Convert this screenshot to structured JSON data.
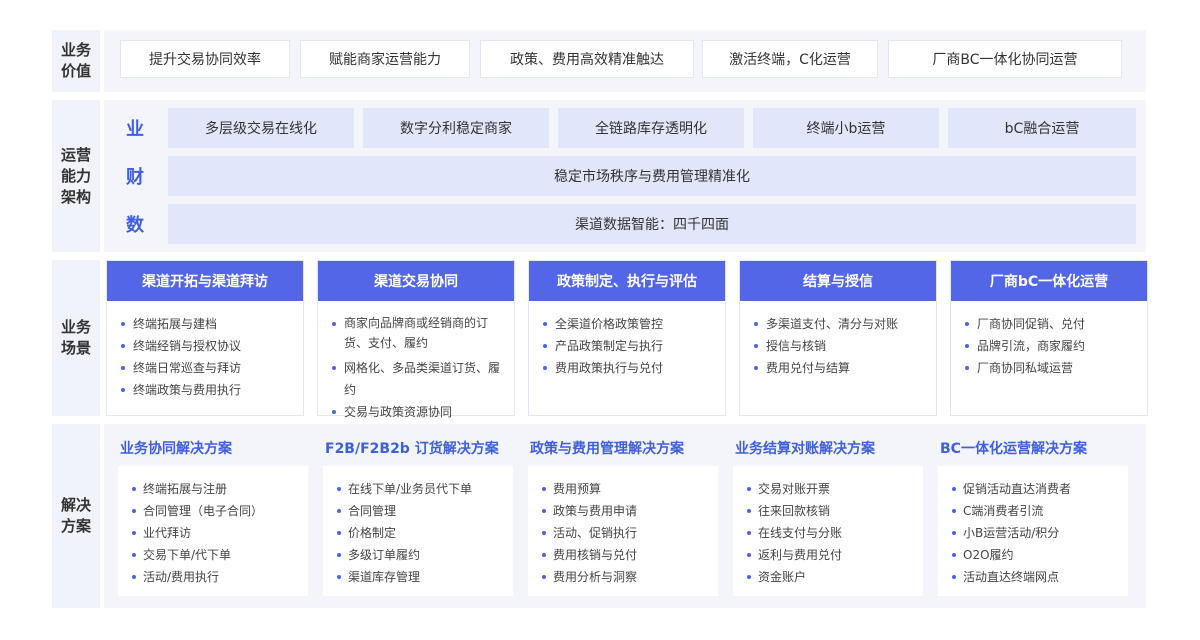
{
  "rows": {
    "value_label": "业务价值",
    "arch_label": "运营能力架构",
    "scene_label": "业务场景",
    "solution_label": "解决方案"
  },
  "value_items": [
    "提升交易协同效率",
    "赋能商家运营能力",
    "政策、费用高效精准触达",
    "激活终端，C化运营",
    "厂商BC一体化协同运营"
  ],
  "arch": {
    "tags": [
      "业",
      "财",
      "数"
    ],
    "biz_cells": [
      "多层级交易在线化",
      "数字分利稳定商家",
      "全链路库存透明化",
      "终端小b运营",
      "bC融合运营"
    ],
    "finance_cell": "稳定市场秩序与费用管理精准化",
    "data_cell": "渠道数据智能：四千四面"
  },
  "scenes": [
    {
      "title": "渠道开拓与渠道拜访",
      "items": [
        "终端拓展与建档",
        "终端经销与授权协议",
        "终端日常巡查与拜访",
        "终端政策与费用执行"
      ]
    },
    {
      "title": "渠道交易协同",
      "items": [
        "商家向品牌商或经销商的订货、支付、履约",
        "网格化、多品类渠道订货、履约",
        "交易与政策资源协同"
      ]
    },
    {
      "title": "政策制定、执行与评估",
      "items": [
        "全渠道价格政策管控",
        "产品政策制定与执行",
        "费用政策执行与兑付"
      ]
    },
    {
      "title": "结算与授信",
      "items": [
        "多渠道支付、清分与对账",
        "授信与核销",
        "费用兑付与结算"
      ]
    },
    {
      "title": "厂商bC一体化运营",
      "items": [
        "厂商协同促销、兑付",
        "品牌引流，商家履约",
        "厂商协同私域运营"
      ]
    }
  ],
  "solutions": [
    {
      "title": "业务协同解决方案",
      "items": [
        "终端拓展与注册",
        "合同管理（电子合同）",
        "业代拜访",
        "交易下单/代下单",
        "活动/费用执行"
      ]
    },
    {
      "title": "F2B/F2B2b 订货解决方案",
      "items": [
        "在线下单/业务员代下单",
        "合同管理",
        "价格制定",
        "多级订单履约",
        "渠道库存管理"
      ]
    },
    {
      "title": "政策与费用管理解决方案",
      "items": [
        "费用预算",
        "政策与费用申请",
        "活动、促销执行",
        "费用核销与兑付",
        "费用分析与洞察"
      ]
    },
    {
      "title": "业务结算对账解决方案",
      "items": [
        "交易对账开票",
        "往来回款核销",
        "在线支付与分账",
        "返利与费用兑付",
        "资金账户"
      ]
    },
    {
      "title": "BC一体化运营解决方案",
      "items": [
        "促销活动直达消费者",
        "C端消费者引流",
        "小B运营活动/积分",
        "O2O履约",
        "活动直达终端网点"
      ]
    }
  ],
  "colors": {
    "accent": "#3f5fe0",
    "header_fill": "#5266e6",
    "cell_fill": "#e2e6fa",
    "panel_bg": "#f3f5fb"
  }
}
